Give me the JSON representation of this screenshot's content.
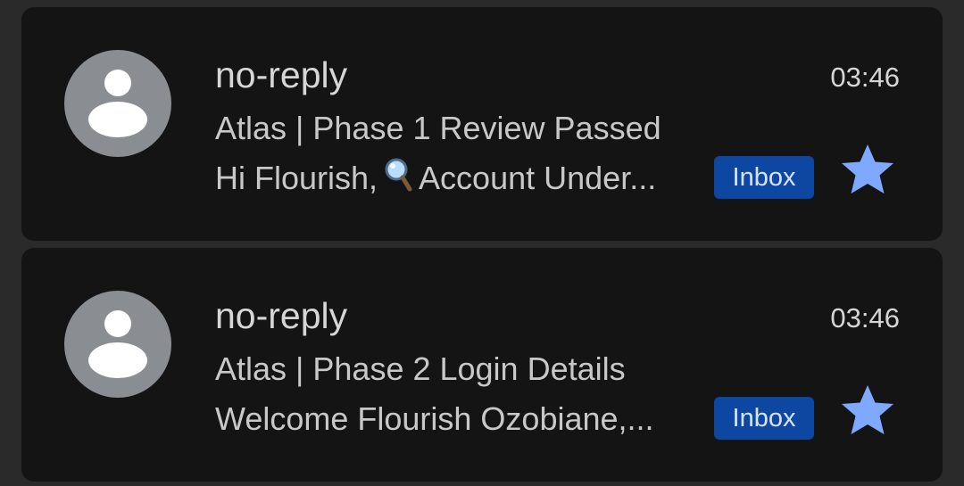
{
  "emails": [
    {
      "sender": "no-reply",
      "time": "03:46",
      "subject": "Atlas | Phase 1 Review Passed",
      "snippet_before_icon": "Hi Flourish,",
      "snippet_icon": "magnifying-glass-icon",
      "snippet_after_icon": "Account Under...",
      "label": "Inbox",
      "starred": true
    },
    {
      "sender": "no-reply",
      "time": "03:46",
      "subject": "Atlas | Phase 2 Login Details",
      "snippet": "Welcome Flourish Ozobiane,...",
      "label": "Inbox",
      "starred": true
    }
  ],
  "colors": {
    "card_background": "#141414",
    "avatar_background": "#8a8d91",
    "label_background": "#0d47a1",
    "star": "#7fa8ff"
  }
}
